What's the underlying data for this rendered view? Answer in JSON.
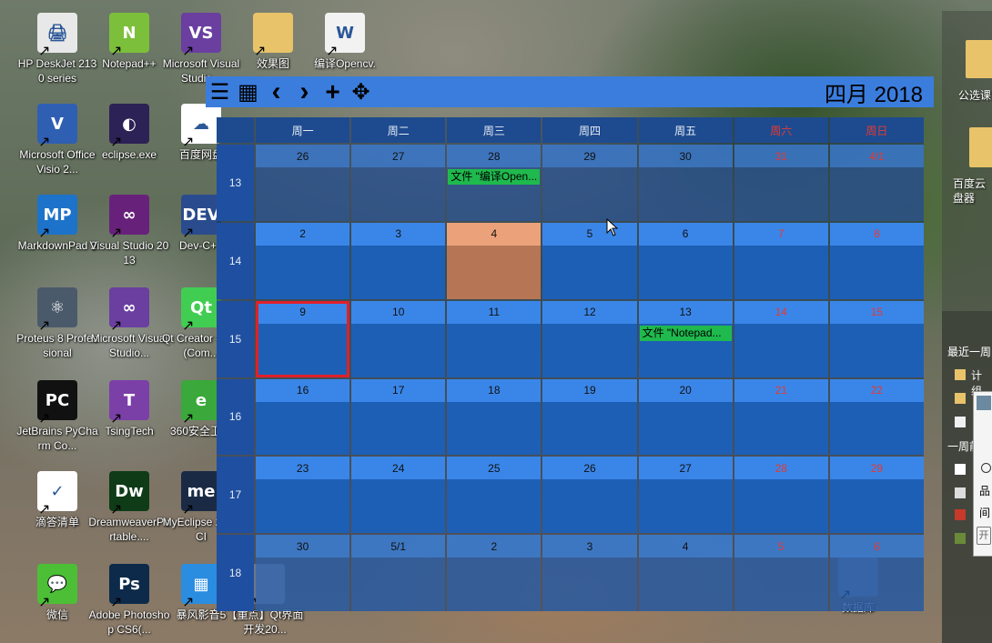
{
  "desktop_icons": [
    {
      "label": "HP DeskJet 2130 series",
      "icon": "printer-icon",
      "color": "#e8e8e8",
      "glyph": "🖨"
    },
    {
      "label": "Notepad++",
      "icon": "notepadpp-icon",
      "color": "#7cbf3a",
      "glyph": "N"
    },
    {
      "label": "Microsoft Visual Studio...",
      "icon": "visual-studio-icon",
      "color": "#6a3fa0",
      "glyph": "VS"
    },
    {
      "label": "效果图",
      "icon": "folder-icon",
      "color": "#e8c36a",
      "glyph": ""
    },
    {
      "label": "编译Opencv.",
      "icon": "word-document-icon",
      "color": "#f2f2f2",
      "glyph": "W"
    },
    {
      "label": "Microsoft Office Visio 2...",
      "icon": "visio-icon",
      "color": "#2f5fb3",
      "glyph": "V"
    },
    {
      "label": "eclipse.exe",
      "icon": "eclipse-icon",
      "color": "#2c2255",
      "glyph": "◐"
    },
    {
      "label": "百度网盘",
      "icon": "baidu-netdisk-icon",
      "color": "#ffffff",
      "glyph": "☁"
    },
    {
      "label": "MarkdownPad 2",
      "icon": "markdownpad-icon",
      "color": "#1d73c9",
      "glyph": "MP"
    },
    {
      "label": "Visual Studio 2013",
      "icon": "visual-studio-2013-icon",
      "color": "#68217a",
      "glyph": "∞"
    },
    {
      "label": "Dev-C++",
      "icon": "devcpp-icon",
      "color": "#2a4c8e",
      "glyph": "DEV"
    },
    {
      "label": "Proteus 8 Professional",
      "icon": "proteus-icon",
      "color": "#4a5a6a",
      "glyph": "⚛"
    },
    {
      "label": "Microsoft Visual Studio...",
      "icon": "visual-studio-2-icon",
      "color": "#6a3fa0",
      "glyph": "∞"
    },
    {
      "label": "Qt Creator 4.2.1 (Com...",
      "icon": "qt-creator-icon",
      "color": "#41cd52",
      "glyph": "Qt"
    },
    {
      "label": "JetBrains PyCharm Co...",
      "icon": "pycharm-icon",
      "color": "#111111",
      "glyph": "PC"
    },
    {
      "label": "TsingTech",
      "icon": "tsingtech-icon",
      "color": "#7b3fa8",
      "glyph": "T"
    },
    {
      "label": "360安全卫士",
      "icon": "360-security-icon",
      "color": "#3aa83a",
      "glyph": "e"
    },
    {
      "label": "滴答清单",
      "icon": "ticktick-icon",
      "color": "#ffffff",
      "glyph": "✓"
    },
    {
      "label": "DreamweaverPortable....",
      "icon": "dreamweaver-icon",
      "color": "#0f3b17",
      "glyph": "Dw"
    },
    {
      "label": "MyEclipse 2017 CI",
      "icon": "myeclipse-icon",
      "color": "#1b2a44",
      "glyph": "me"
    },
    {
      "label": "微信",
      "icon": "wechat-icon",
      "color": "#4cbf36",
      "glyph": "💬"
    },
    {
      "label": "Adobe Photoshop CS6(...",
      "icon": "photoshop-icon",
      "color": "#0d2a4a",
      "glyph": "Ps"
    },
    {
      "label": "暴风影音5",
      "icon": "baofeng-icon",
      "color": "#2a8de0",
      "glyph": "▦"
    },
    {
      "label": "【重点】Qt界面开发20...",
      "icon": "document-icon",
      "color": "#cccccc",
      "glyph": ""
    },
    {
      "label": "数据库",
      "icon": "database-folder-icon",
      "color": "#8fa3c0",
      "glyph": ""
    }
  ],
  "right_panel": {
    "icon1_label": "公选课",
    "icon2_label": "百度云盘器",
    "recent_header": "最近一周",
    "recent_item": "计组",
    "week_header": "一周前",
    "chars": [
      "品",
      "间"
    ],
    "button": "开"
  },
  "toolbar": {
    "menu_icon": "☰",
    "calendar_icon": "▦",
    "prev_icon": "‹",
    "next_icon": "›",
    "add_icon": "+",
    "move_icon": "✥",
    "title": "四月 2018"
  },
  "calendar": {
    "weekday_headers": [
      "周一",
      "周二",
      "周三",
      "周四",
      "周五",
      "周六",
      "周日"
    ],
    "weeks": [
      {
        "week": "13",
        "days": [
          "26",
          "27",
          "28",
          "29",
          "30",
          "31",
          "4/1"
        ]
      },
      {
        "week": "14",
        "days": [
          "2",
          "3",
          "4",
          "5",
          "6",
          "7",
          "8"
        ]
      },
      {
        "week": "15",
        "days": [
          "9",
          "10",
          "11",
          "12",
          "13",
          "14",
          "15"
        ]
      },
      {
        "week": "16",
        "days": [
          "16",
          "17",
          "18",
          "19",
          "20",
          "21",
          "22"
        ]
      },
      {
        "week": "17",
        "days": [
          "23",
          "24",
          "25",
          "26",
          "27",
          "28",
          "29"
        ]
      },
      {
        "week": "18",
        "days": [
          "30",
          "5/1",
          "2",
          "3",
          "4",
          "5",
          "6"
        ]
      }
    ],
    "today": {
      "week_index": 1,
      "day_index": 2
    },
    "selected": {
      "week_index": 2,
      "day_index": 0
    },
    "events": [
      {
        "week_index": 0,
        "day_index": 2,
        "text": "文件 \"编译Open..."
      },
      {
        "week_index": 2,
        "day_index": 4,
        "text": "文件 \"Notepad..."
      }
    ]
  },
  "colors": {
    "toolbar_bg": "#3b7ddd",
    "header_bg": "#1e4b8f",
    "cell_bg": "#1d5fb5",
    "date_bar": "#3a86e8",
    "today": "#eba27a",
    "event": "#1fb94e",
    "weekend_text": "#e53935",
    "selected_border": "#e0202a"
  }
}
